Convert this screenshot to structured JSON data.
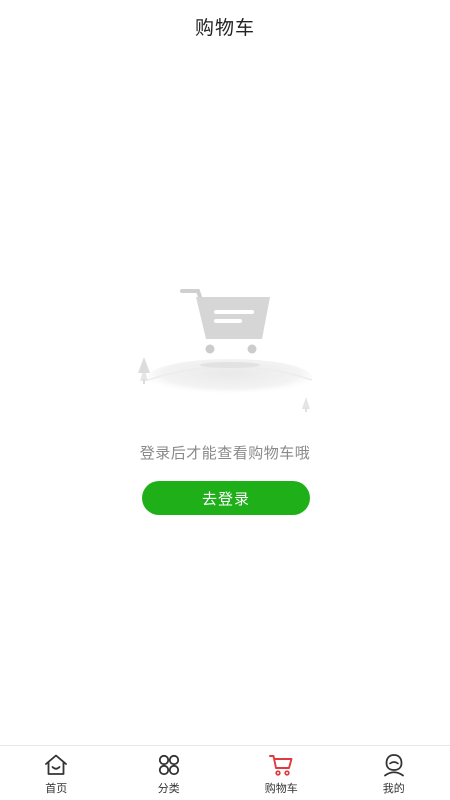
{
  "header": {
    "title": "购物车"
  },
  "empty_state": {
    "message": "登录后才能查看购物车哦",
    "button_label": "去登录"
  },
  "tabbar": {
    "items": [
      {
        "label": "首页",
        "icon": "home-icon",
        "active": false
      },
      {
        "label": "分类",
        "icon": "grid-icon",
        "active": false
      },
      {
        "label": "购物车",
        "icon": "cart-icon",
        "active": true
      },
      {
        "label": "我的",
        "icon": "profile-icon",
        "active": false
      }
    ]
  },
  "colors": {
    "accent": "#1fb019",
    "active_tab_icon": "#e0393e",
    "icon_default": "#333333",
    "muted_text": "#8a8a8a"
  }
}
